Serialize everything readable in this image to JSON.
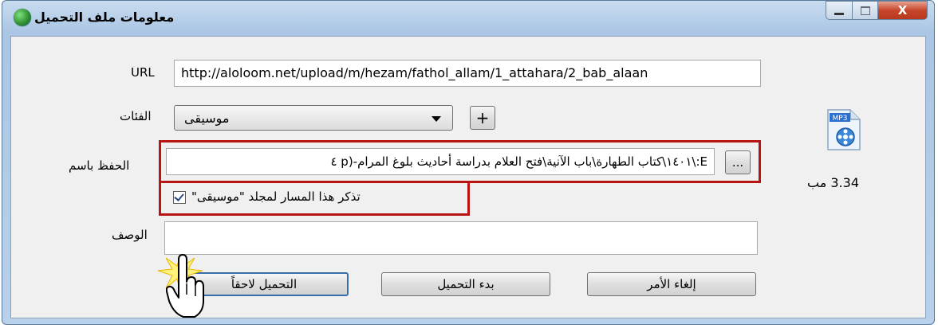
{
  "window": {
    "title": "معلومات ملف التحميل"
  },
  "caption_buttons": {
    "close": "X"
  },
  "url": {
    "label": "URL",
    "value": "http://aloloom.net/upload/m/hezam/fathol_allam/1_attahara/2_bab_alaan"
  },
  "category": {
    "label": "الفئات",
    "value": "موسيقى",
    "add_button": "+"
  },
  "save_as": {
    "label": "الحفظ باسم",
    "value": "E:\\١٤٠١\\كتاب الطهارة\\باب الآنية\\فتح العلام بدراسة أحاديث بلوغ المرام-(p ٤",
    "browse_button": "..."
  },
  "remember": {
    "label": "تذكر هذا المسار لمجلد \"موسيقى\"",
    "checked": true
  },
  "description": {
    "label": "الوصف",
    "value": ""
  },
  "file": {
    "type": "MP3",
    "size": "3.34  مب"
  },
  "buttons": {
    "download_later": "التحميل لاحقاً",
    "start_download": "بدء التحميل",
    "cancel": "إلغاء الأمر"
  },
  "colors": {
    "highlight": "#b91414",
    "title_bar": "#b9d1ea",
    "close_button": "#c7462b"
  }
}
